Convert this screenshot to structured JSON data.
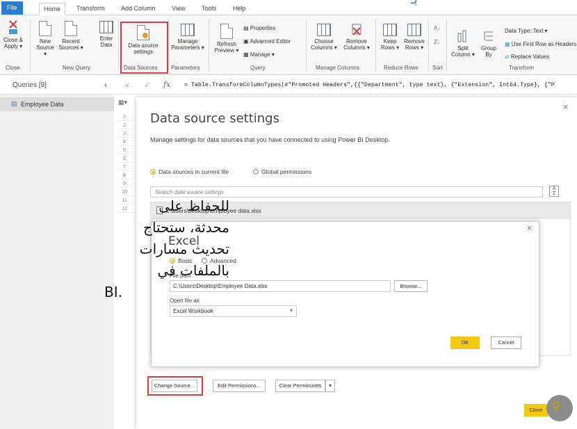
{
  "ribbon": {
    "tabs": [
      "File",
      "Home",
      "Transform",
      "Add Column",
      "View",
      "Tools",
      "Help"
    ],
    "active_tab": "Home",
    "buttons": {
      "close_apply": "Close & Apply ▾",
      "new_source": "New Source ▾",
      "recent_sources": "Recent Sources ▾",
      "enter_data": "Enter Data",
      "data_source_settings": "Data source settings",
      "manage_parameters": "Manage Parameters ▾",
      "refresh_preview": "Refresh Preview ▾",
      "properties": "Properties",
      "advanced_editor": "Advanced Editor",
      "manage": "Manage ▾",
      "choose_columns": "Choose Columns ▾",
      "remove_columns": "Remove Columns ▾",
      "keep_rows": "Keep Rows ▾",
      "remove_rows": "Remove Rows ▾",
      "split_column": "Split Column ▾",
      "group_by": "Group By",
      "data_type": "Data Type: Text ▾",
      "use_first_row": "Use First Row as Headers ▾",
      "replace_values": "Replace Values"
    },
    "groups": {
      "close": "Close",
      "new_query": "New Query",
      "data_sources": "Data Sources",
      "parameters": "Parameters",
      "query": "Query",
      "manage_columns": "Manage Columns",
      "reduce_rows": "Reduce Rows",
      "sort": "Sort",
      "transform": "Transform"
    }
  },
  "queries": {
    "header": "Queries [9]",
    "items": [
      "Employee Data"
    ]
  },
  "formula": {
    "text": "= Table.TransformColumnTypes(#\"Promoted Headers\",{{\"Department\", type text}, {\"Extension\", Int64.Type}, {\"P"
  },
  "row_numbers": [
    "1",
    "2",
    "3",
    "4",
    "5",
    "6",
    "7",
    "8",
    "9",
    "10",
    "11",
    "12"
  ],
  "data_source_dialog": {
    "title": "Data source settings",
    "description": "Manage settings for data sources that you have connected to using Power BI Desktop.",
    "radio_current": "Data sources in current file",
    "radio_global": "Global permissions",
    "search_placeholder": "Search data source settings",
    "source_path": "c:\\users\\desktop\\employee data.xlsx",
    "change_source": "Change Source...",
    "edit_permissions": "Edit Permissions...",
    "clear_permissions": "Clear Permissions",
    "close": "Close"
  },
  "excel_dialog": {
    "title": "Excel",
    "radio_basic": "Basic",
    "radio_advanced": "Advanced",
    "file_path_label": "File path",
    "file_path_value": "C:\\Users\\Desktop\\Employee Data.xlsx",
    "browse": "Browse...",
    "open_as_label": "Open file as",
    "open_as_value": "Excel Workbook",
    "ok": "OK",
    "cancel": "Cancel"
  },
  "arabic_overlay": {
    "lines": [
      "للحفاظ على",
      "محدثة، ستحتاج",
      "تحديث مسارات",
      "بالملفات في",
      "BI."
    ]
  },
  "colors": {
    "file_tab": "#2b7bd0",
    "highlight": "#e03a3a",
    "primary_button": "#f2c811"
  }
}
